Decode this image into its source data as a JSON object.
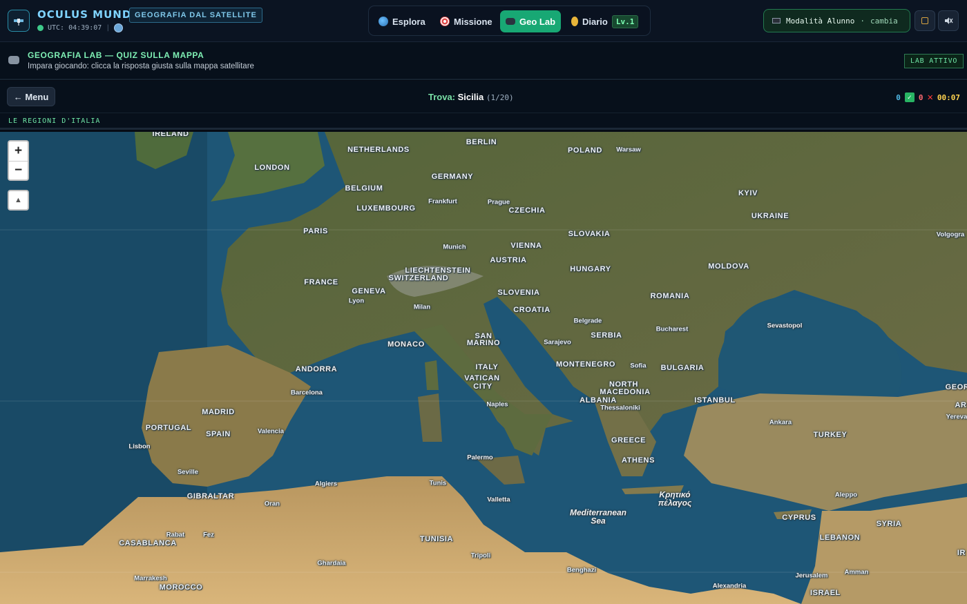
{
  "header": {
    "brand": "OCULUS MUNDI",
    "brand_badge": "GEOGRAFIA DAL SATELLITE",
    "utc": "UTC: 04:39:07",
    "nav": [
      {
        "label": "Esplora",
        "icon": "globe-icon"
      },
      {
        "label": "Missione",
        "icon": "target-icon"
      },
      {
        "label": "Geo Lab",
        "icon": "gamepad-icon",
        "active": true
      },
      {
        "label": "Diario",
        "icon": "medal-icon"
      }
    ],
    "level": "Lv.1",
    "mode": "Modalità Alunno",
    "mode_sep": "·",
    "mode_change": "cambia"
  },
  "banner": {
    "title": "GEOGRAFIA LAB — QUIZ SULLA MAPPA",
    "subtitle": "Impara giocando: clicca la risposta giusta sulla mappa satellitare",
    "status": "LAB ATTIVO"
  },
  "quiz": {
    "back_label": "← Menu",
    "find_label": "Trova:",
    "target": "Sicilia",
    "progress": "(1/20)",
    "correct": "0",
    "wrong": "0",
    "timer": "00:07",
    "category": "LE REGIONI D'ITALIA"
  },
  "map": {
    "zoom_in": "+",
    "zoom_out": "−",
    "colors": {
      "sea": "#1f5a78",
      "land": "#5e6b3e",
      "desert": "#c9a66a"
    },
    "labels": [
      {
        "t": "IRELAND",
        "k": "country"
      },
      {
        "t": "NETHERLANDS",
        "k": "country"
      },
      {
        "t": "BERLIN",
        "k": "country"
      },
      {
        "t": "POLAND",
        "k": "country"
      },
      {
        "t": "Warsaw",
        "k": "city"
      },
      {
        "t": "LONDON",
        "k": "country"
      },
      {
        "t": "GERMANY",
        "k": "country"
      },
      {
        "t": "BELGIUM",
        "k": "country"
      },
      {
        "t": "KYIV",
        "k": "country"
      },
      {
        "t": "Frankfurt",
        "k": "city"
      },
      {
        "t": "Prague",
        "k": "city"
      },
      {
        "t": "LUXEMBOURG",
        "k": "country"
      },
      {
        "t": "CZECHIA",
        "k": "country"
      },
      {
        "t": "UKRAINE",
        "k": "country"
      },
      {
        "t": "PARIS",
        "k": "country"
      },
      {
        "t": "SLOVAKIA",
        "k": "country"
      },
      {
        "t": "Volgogra",
        "k": "city"
      },
      {
        "t": "Munich",
        "k": "city"
      },
      {
        "t": "VIENNA",
        "k": "country"
      },
      {
        "t": "AUSTRIA",
        "k": "country"
      },
      {
        "t": "MOLDOVA",
        "k": "country"
      },
      {
        "t": "LIECHTENSTEIN",
        "k": "country"
      },
      {
        "t": "HUNGARY",
        "k": "country"
      },
      {
        "t": "SWITZERLAND",
        "k": "country"
      },
      {
        "t": "FRANCE",
        "k": "country"
      },
      {
        "t": "GENEVA",
        "k": "country"
      },
      {
        "t": "SLOVENIA",
        "k": "country"
      },
      {
        "t": "ROMANIA",
        "k": "country"
      },
      {
        "t": "Lyon",
        "k": "city"
      },
      {
        "t": "Milan",
        "k": "city"
      },
      {
        "t": "CROATIA",
        "k": "country"
      },
      {
        "t": "Belgrade",
        "k": "city"
      },
      {
        "t": "Sevastopol",
        "k": "city"
      },
      {
        "t": "Bucharest",
        "k": "city"
      },
      {
        "t": "SAN",
        "k": "country"
      },
      {
        "t": "MARINO",
        "k": "country"
      },
      {
        "t": "SERBIA",
        "k": "country"
      },
      {
        "t": "MONACO",
        "k": "country"
      },
      {
        "t": "Sarajevo",
        "k": "city"
      },
      {
        "t": "MONTENEGRO",
        "k": "country"
      },
      {
        "t": "Sofia",
        "k": "city"
      },
      {
        "t": "BULGARIA",
        "k": "country"
      },
      {
        "t": "ANDORRA",
        "k": "country"
      },
      {
        "t": "ITALY",
        "k": "country"
      },
      {
        "t": "VATICAN",
        "k": "country"
      },
      {
        "t": "CITY",
        "k": "country"
      },
      {
        "t": "NORTH",
        "k": "country"
      },
      {
        "t": "MACEDONIA",
        "k": "country"
      },
      {
        "t": "GEOR",
        "k": "country"
      },
      {
        "t": "Barcelona",
        "k": "city"
      },
      {
        "t": "ALBANIA",
        "k": "country"
      },
      {
        "t": "ISTANBUL",
        "k": "country"
      },
      {
        "t": "AR",
        "k": "country"
      },
      {
        "t": "Naples",
        "k": "city"
      },
      {
        "t": "Thessaloniki",
        "k": "city"
      },
      {
        "t": "MADRID",
        "k": "country"
      },
      {
        "t": "Yereva",
        "k": "city"
      },
      {
        "t": "Ankara",
        "k": "city"
      },
      {
        "t": "PORTUGAL",
        "k": "country"
      },
      {
        "t": "SPAIN",
        "k": "country"
      },
      {
        "t": "Valencia",
        "k": "city"
      },
      {
        "t": "TURKEY",
        "k": "country"
      },
      {
        "t": "GREECE",
        "k": "country"
      },
      {
        "t": "Lisbon",
        "k": "city"
      },
      {
        "t": "Palermo",
        "k": "city"
      },
      {
        "t": "ATHENS",
        "k": "country"
      },
      {
        "t": "Seville",
        "k": "city"
      },
      {
        "t": "Algiers",
        "k": "city"
      },
      {
        "t": "Tunis",
        "k": "city"
      },
      {
        "t": "Κρητικό",
        "k": "sea"
      },
      {
        "t": "πέλαγος",
        "k": "sea"
      },
      {
        "t": "Aleppo",
        "k": "city"
      },
      {
        "t": "GIBRALTAR",
        "k": "country"
      },
      {
        "t": "Valletta",
        "k": "city"
      },
      {
        "t": "Oran",
        "k": "city"
      },
      {
        "t": "Mediterranean",
        "k": "sea"
      },
      {
        "t": "Sea",
        "k": "sea"
      },
      {
        "t": "CYPRUS",
        "k": "country"
      },
      {
        "t": "SYRIA",
        "k": "country"
      },
      {
        "t": "Rabat",
        "k": "city"
      },
      {
        "t": "Fez",
        "k": "city"
      },
      {
        "t": "TUNISIA",
        "k": "country"
      },
      {
        "t": "LEBANON",
        "k": "country"
      },
      {
        "t": "CASABLANCA",
        "k": "country"
      },
      {
        "t": "IR",
        "k": "country"
      },
      {
        "t": "Tripoli",
        "k": "city"
      },
      {
        "t": "Ghardaia",
        "k": "city"
      },
      {
        "t": "Benghazi",
        "k": "city"
      },
      {
        "t": "Amman",
        "k": "city"
      },
      {
        "t": "Jerusalem",
        "k": "city"
      },
      {
        "t": "Marrakesh",
        "k": "city"
      },
      {
        "t": "MOROCCO",
        "k": "country"
      },
      {
        "t": "Alexandria",
        "k": "city"
      },
      {
        "t": "ISRAEL",
        "k": "country"
      }
    ]
  }
}
